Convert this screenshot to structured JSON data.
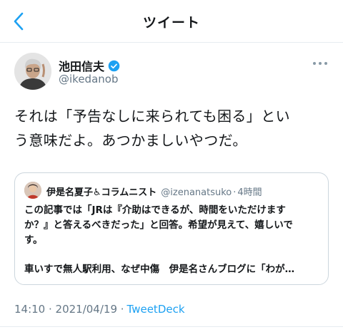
{
  "header": {
    "title": "ツイート",
    "back_icon": "chevron-left-icon"
  },
  "tweet": {
    "author": {
      "display_name": "池田信夫",
      "handle": "@ikedanob",
      "verified": true
    },
    "text_line1": "それは「予告なしに来られても困る」とい",
    "text_line2": "う意味だよ。あつかましいやつだ。",
    "timestamp": "14:10 · 2021/04/19 ·",
    "source": "TweetDeck"
  },
  "quoted_tweet": {
    "display_name": "伊是名夏子♿コラムニスト",
    "handle": "@izenanatsuko",
    "separator": "·",
    "time": "4時間",
    "text_lines": [
      "この記事では「JRは『介助はできるが、時間をいただけます",
      "か？』と答えるべきだった」と回答。希望が見えて、嬉しいで",
      "す。"
    ],
    "text_second": "車いすで無人駅利用、なぜ中傷　伊是名さんブログに「わが…"
  },
  "colors": {
    "accent": "#1da1f2",
    "secondary_text": "#657786",
    "border": "#e6ecf0"
  }
}
